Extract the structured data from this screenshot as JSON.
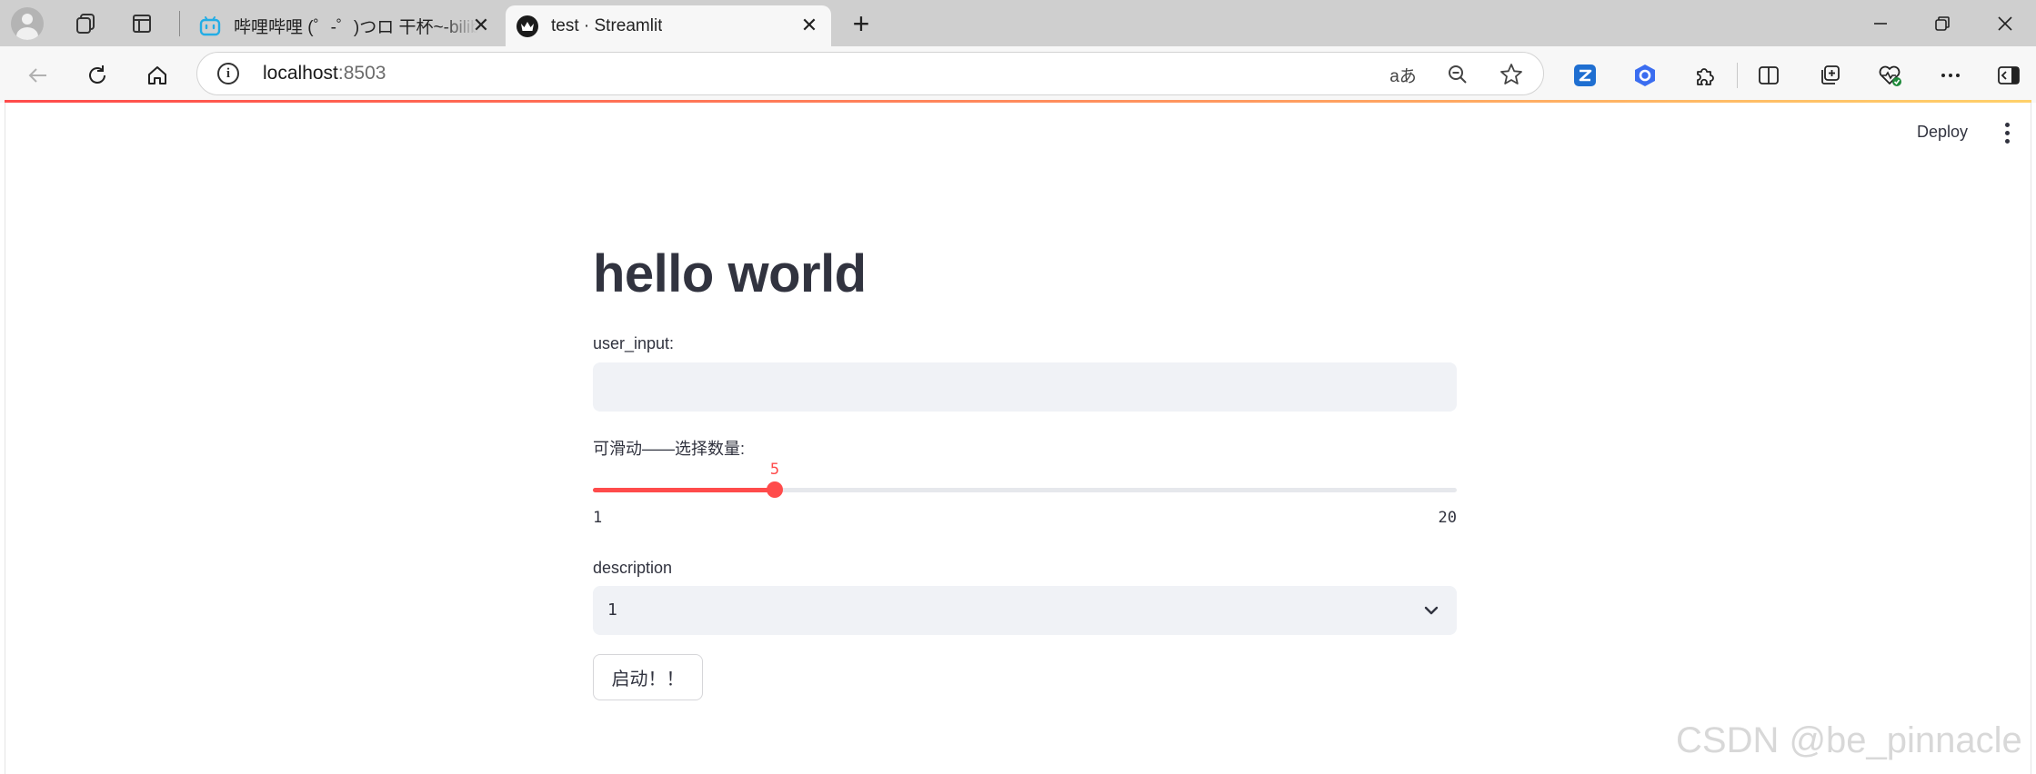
{
  "browser": {
    "tabs": [
      {
        "title": "哔哩哔哩 (゜-゜)つロ 干杯~-bilibili",
        "favicon": "bilibili-icon",
        "active": false
      },
      {
        "title": "test · Streamlit",
        "favicon": "streamlit-icon",
        "active": true
      }
    ],
    "address": {
      "host": "localhost",
      "port": ":8503"
    },
    "read_aloud_glyph": "aあ"
  },
  "app": {
    "deploy_label": "Deploy",
    "title": "hello world",
    "text_input": {
      "label": "user_input:",
      "value": ""
    },
    "slider": {
      "label": "可滑动——选择数量:",
      "value": "5",
      "min": "1",
      "max": "20",
      "accent": "#ff4b4b"
    },
    "select": {
      "label": "description",
      "value": "1"
    },
    "button_label": "启动！！"
  },
  "watermark": "CSDN @be_pinnacle"
}
